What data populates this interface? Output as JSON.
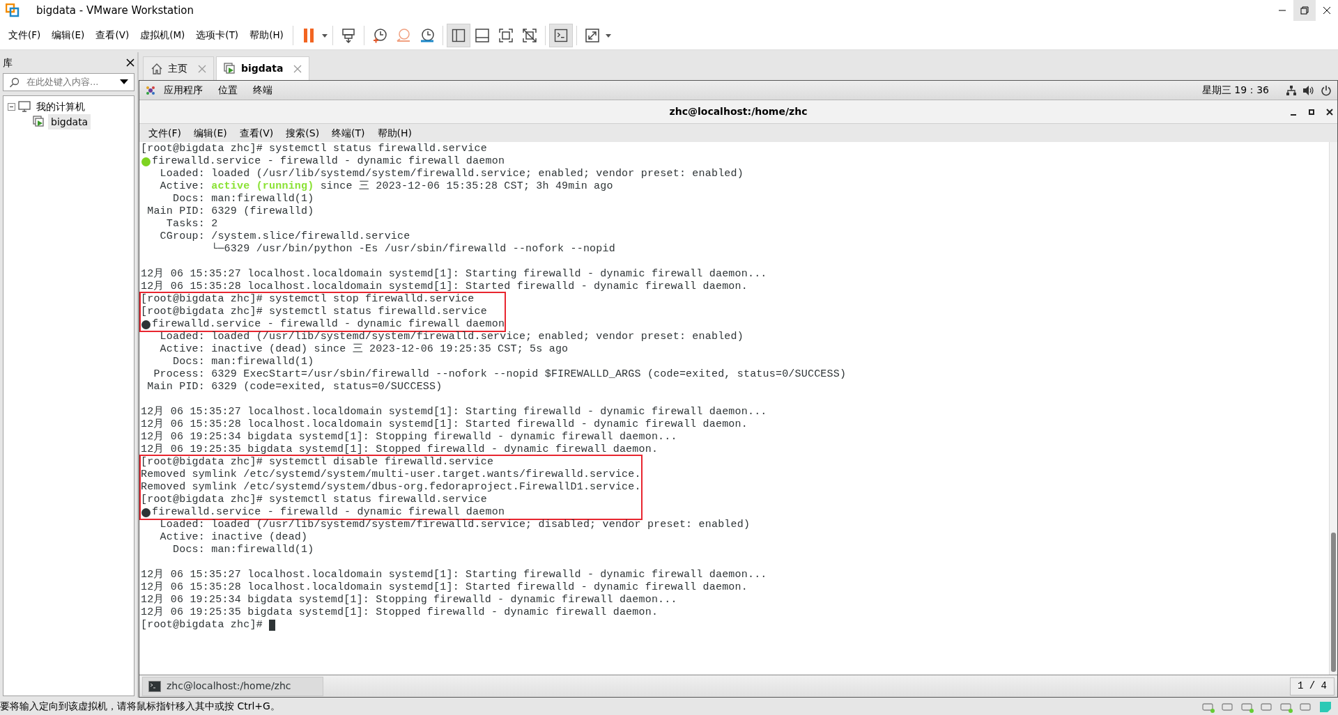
{
  "window": {
    "title": "bigdata - VMware Workstation"
  },
  "menu": [
    "文件(F)",
    "编辑(E)",
    "查看(V)",
    "虚拟机(M)",
    "选项卡(T)",
    "帮助(H)"
  ],
  "library": {
    "title": "库",
    "search": {
      "placeholder": "在此处键入内容..."
    },
    "tree": [
      {
        "label": "我的计算机",
        "expanded": true,
        "selected": false,
        "children": [
          {
            "label": "bigdata",
            "selected": true
          }
        ]
      }
    ]
  },
  "tabs": [
    {
      "label": "主页",
      "kind": "home",
      "selected": false
    },
    {
      "label": "bigdata",
      "kind": "vm",
      "selected": true
    }
  ],
  "guest_topbar": {
    "menus": [
      "应用程序",
      "位置",
      "终端"
    ],
    "clock": "星期三 19：36"
  },
  "terminal": {
    "title": "zhc@localhost:/home/zhc",
    "menu": [
      "文件(F)",
      "编辑(E)",
      "查看(V)",
      "搜索(S)",
      "终端(T)",
      "帮助(H)"
    ],
    "blocks": [
      {
        "highlighted": false,
        "lines": [
          {
            "kind": "text",
            "parts": [
              {
                "text": "[root@bigdata zhc]# systemctl status firewalld.service"
              }
            ]
          },
          {
            "kind": "text",
            "color": "#7ed321",
            "parts": [
              {
                "text": "firewalld.service - firewalld - dynamic firewall daemon"
              }
            ]
          },
          {
            "kind": "text",
            "parts": [
              {
                "text": "   Loaded: loaded (/usr/lib/systemd/system/firewalld.service; enabled; vendor preset: enabled)"
              }
            ]
          },
          {
            "kind": "text",
            "parts": [
              {
                "text": "   Active: "
              },
              {
                "text": "active (running)",
                "color": "#8ae234"
              },
              {
                "text": " since 三 2023-12-06 15:35:28 CST; 3h 49min ago"
              }
            ]
          },
          {
            "kind": "text",
            "parts": [
              {
                "text": "     Docs: man:firewalld(1)"
              }
            ]
          },
          {
            "kind": "text",
            "parts": [
              {
                "text": " Main PID: 6329 (firewalld)"
              }
            ]
          },
          {
            "kind": "text",
            "parts": [
              {
                "text": "    Tasks: 2"
              }
            ]
          },
          {
            "kind": "text",
            "parts": [
              {
                "text": "   CGroup: /system.slice/firewalld.service"
              }
            ]
          },
          {
            "kind": "text",
            "parts": [
              {
                "text": "           └─6329 /usr/bin/python -Es /usr/sbin/firewalld --nofork --nopid"
              }
            ]
          },
          {
            "kind": "blank"
          },
          {
            "kind": "text",
            "parts": [
              {
                "text": "12月 06 15:35:27 localhost.localdomain systemd[1]: Starting firewalld - dynamic firewall daemon..."
              }
            ]
          },
          {
            "kind": "text",
            "parts": [
              {
                "text": "12月 06 15:35:28 localhost.localdomain systemd[1]: Started firewalld - dynamic firewall daemon."
              }
            ]
          }
        ]
      },
      {
        "highlighted": true,
        "lines": [
          {
            "kind": "text",
            "parts": [
              {
                "text": "[root@bigdata zhc]# systemctl stop firewalld.service"
              }
            ]
          },
          {
            "kind": "text",
            "parts": [
              {
                "text": "[root@bigdata zhc]# systemctl status firewalld.service"
              }
            ]
          },
          {
            "kind": "text",
            "color": "#2e3436",
            "parts": [
              {
                "text": "firewalld.service - firewalld - dynamic firewall daemon"
              }
            ]
          }
        ]
      },
      {
        "highlighted": false,
        "lines": [
          {
            "kind": "text",
            "parts": [
              {
                "text": "   Loaded: loaded (/usr/lib/systemd/system/firewalld.service; enabled; vendor preset: enabled)"
              }
            ]
          },
          {
            "kind": "text",
            "parts": [
              {
                "text": "   Active: inactive (dead) since 三 2023-12-06 19:25:35 CST; 5s ago"
              }
            ]
          },
          {
            "kind": "text",
            "parts": [
              {
                "text": "     Docs: man:firewalld(1)"
              }
            ]
          },
          {
            "kind": "text",
            "parts": [
              {
                "text": "  Process: 6329 ExecStart=/usr/sbin/firewalld --nofork --nopid $FIREWALLD_ARGS (code=exited, status=0/SUCCESS)"
              }
            ]
          },
          {
            "kind": "text",
            "parts": [
              {
                "text": " Main PID: 6329 (code=exited, status=0/SUCCESS)"
              }
            ]
          },
          {
            "kind": "blank"
          },
          {
            "kind": "text",
            "parts": [
              {
                "text": "12月 06 15:35:27 localhost.localdomain systemd[1]: Starting firewalld - dynamic firewall daemon..."
              }
            ]
          },
          {
            "kind": "text",
            "parts": [
              {
                "text": "12月 06 15:35:28 localhost.localdomain systemd[1]: Started firewalld - dynamic firewall daemon."
              }
            ]
          },
          {
            "kind": "text",
            "parts": [
              {
                "text": "12月 06 19:25:34 bigdata systemd[1]: Stopping firewalld - dynamic firewall daemon..."
              }
            ]
          },
          {
            "kind": "text",
            "parts": [
              {
                "text": "12月 06 19:25:35 bigdata systemd[1]: Stopped firewalld - dynamic firewall daemon."
              }
            ]
          }
        ]
      },
      {
        "highlighted": true,
        "lines": [
          {
            "kind": "text",
            "parts": [
              {
                "text": "[root@bigdata zhc]# systemctl disable firewalld.service"
              }
            ]
          },
          {
            "kind": "text",
            "parts": [
              {
                "text": "Removed symlink /etc/systemd/system/multi-user.target.wants/firewalld.service."
              }
            ]
          },
          {
            "kind": "text",
            "parts": [
              {
                "text": "Removed symlink /etc/systemd/system/dbus-org.fedoraproject.FirewallD1.service."
              }
            ]
          },
          {
            "kind": "text",
            "parts": [
              {
                "text": "[root@bigdata zhc]# systemctl status firewalld.service"
              }
            ]
          },
          {
            "kind": "text",
            "color": "#2e3436",
            "parts": [
              {
                "text": "firewalld.service - firewalld - dynamic firewall daemon"
              }
            ]
          }
        ]
      },
      {
        "highlighted": false,
        "lines": [
          {
            "kind": "text",
            "parts": [
              {
                "text": "   Loaded: loaded (/usr/lib/systemd/system/firewalld.service; disabled; vendor preset: enabled)"
              }
            ]
          },
          {
            "kind": "text",
            "parts": [
              {
                "text": "   Active: inactive (dead)"
              }
            ]
          },
          {
            "kind": "text",
            "parts": [
              {
                "text": "     Docs: man:firewalld(1)"
              }
            ]
          },
          {
            "kind": "blank"
          },
          {
            "kind": "text",
            "parts": [
              {
                "text": "12月 06 15:35:27 localhost.localdomain systemd[1]: Starting firewalld - dynamic firewall daemon..."
              }
            ]
          },
          {
            "kind": "text",
            "parts": [
              {
                "text": "12月 06 15:35:28 localhost.localdomain systemd[1]: Started firewalld - dynamic firewall daemon."
              }
            ]
          },
          {
            "kind": "text",
            "parts": [
              {
                "text": "12月 06 19:25:34 bigdata systemd[1]: Stopping firewalld - dynamic firewall daemon..."
              }
            ]
          },
          {
            "kind": "text",
            "parts": [
              {
                "text": "12月 06 19:25:35 bigdata systemd[1]: Stopped firewalld - dynamic firewall daemon."
              }
            ]
          },
          {
            "kind": "text",
            "cursor": true,
            "parts": [
              {
                "text": "[root@bigdata zhc]# "
              }
            ]
          }
        ]
      }
    ]
  },
  "taskbar": {
    "window_button": "zhc@localhost:/home/zhc",
    "workspace": "1 / 4"
  },
  "status_bar": {
    "message": "要将输入定向到该虚拟机，请将鼠标指针移入其中或按 Ctrl+G。"
  }
}
